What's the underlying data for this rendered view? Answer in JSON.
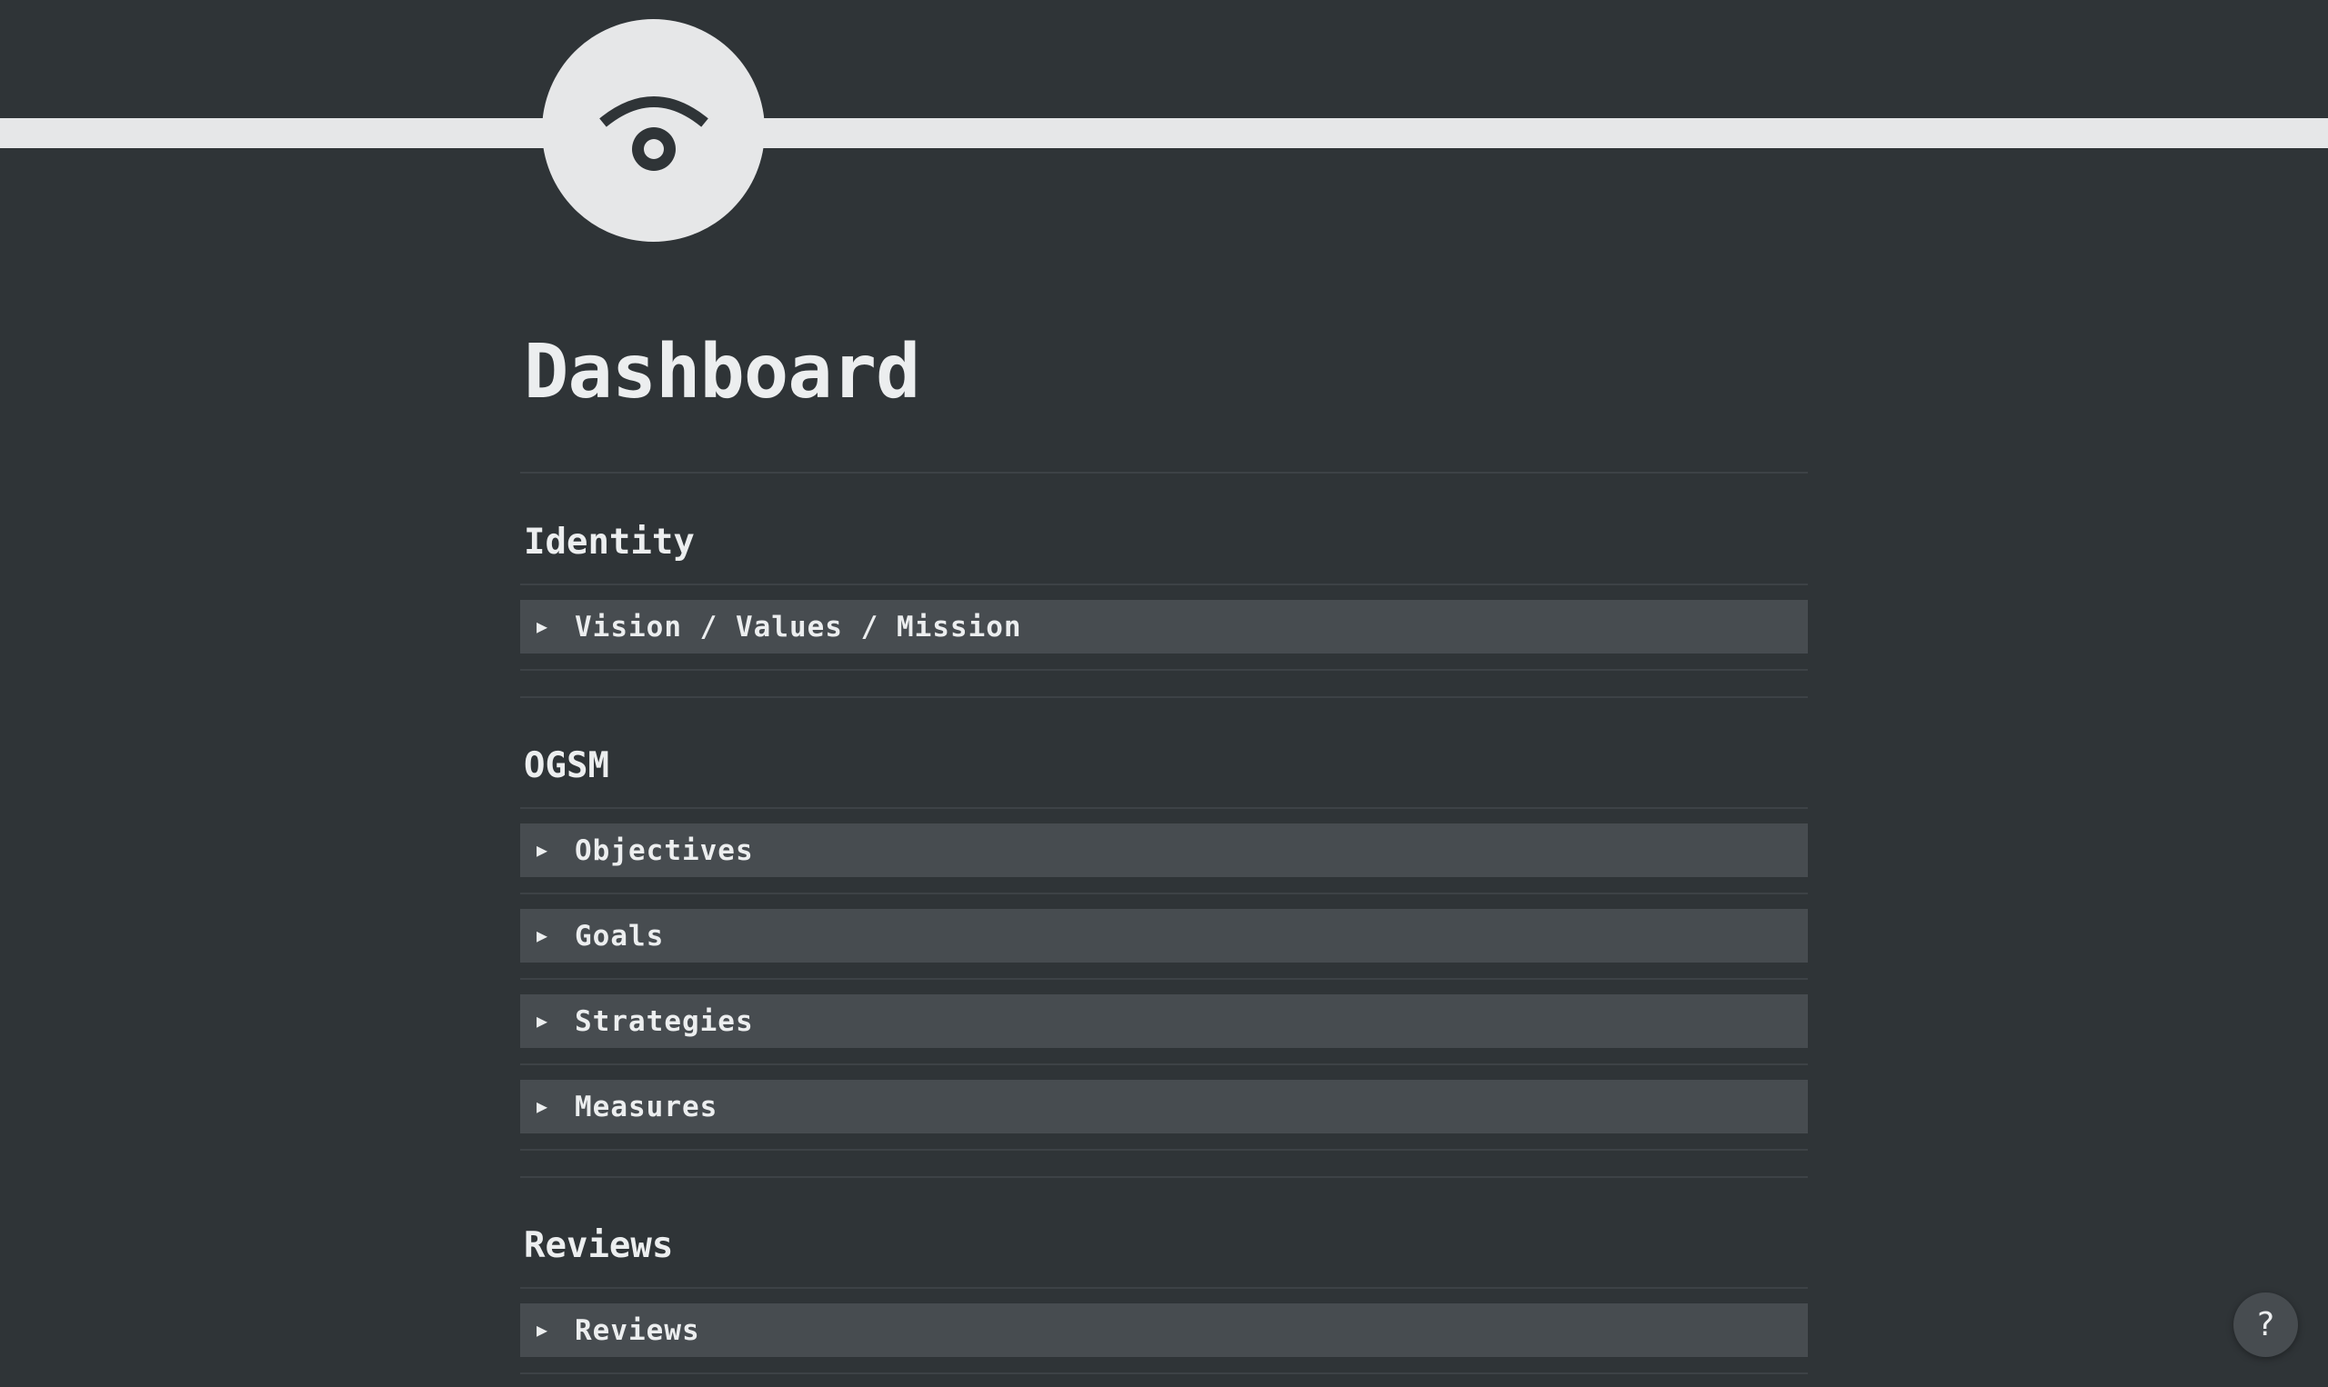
{
  "page": {
    "title": "Dashboard",
    "icon": "eye-icon"
  },
  "sections": {
    "identity": {
      "heading": "Identity",
      "toggles": [
        "Vision / Values / Mission"
      ]
    },
    "ogsm": {
      "heading": "OGSM",
      "toggles": [
        "Objectives",
        "Goals",
        "Strategies",
        "Measures"
      ]
    },
    "reviews": {
      "heading": "Reviews",
      "toggles": [
        "Reviews"
      ]
    }
  },
  "help": {
    "label": "?"
  },
  "colors": {
    "background": "#2f3437",
    "cover": "#e6e7e8",
    "toggle_background": "#474c50",
    "text": "#eceeef"
  }
}
